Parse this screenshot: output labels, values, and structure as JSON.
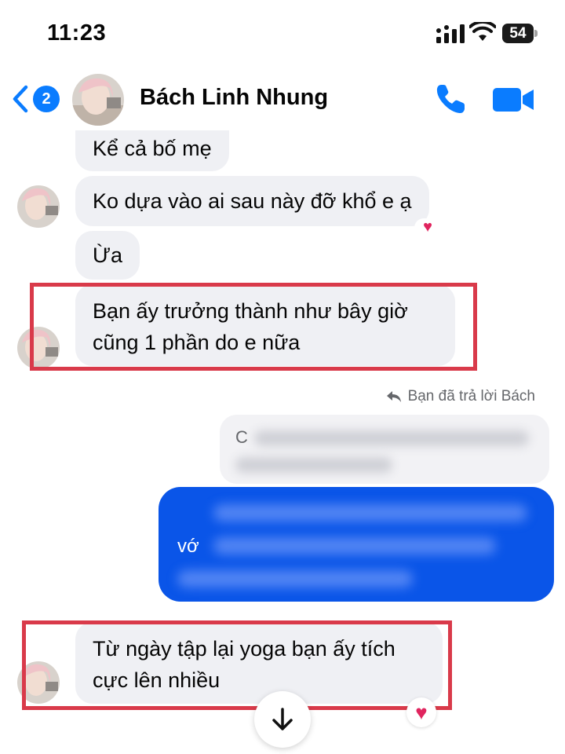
{
  "status_bar": {
    "time": "11:23",
    "battery": "54"
  },
  "header": {
    "back_badge_count": "2",
    "contact_name": "Bách Linh Nhung",
    "call_icon": "phone-icon",
    "video_icon": "video-camera-icon",
    "accent_color": "#0a7cff"
  },
  "messages": [
    {
      "text": "Kể cả bố mẹ"
    },
    {
      "text": "Ko dựa vào ai sau này đỡ khổ e ạ",
      "reaction": "heart"
    },
    {
      "text": "Ừa"
    },
    {
      "text_line1": "Bạn ấy trưởng thành như bây giờ",
      "text_line2": "cũng 1 phần do e nữa",
      "highlighted": true
    },
    {
      "text_line1": "Từ ngày tập lại yoga bạn ấy tích",
      "text_line2": "cực lên nhiều",
      "highlighted": true,
      "reaction": "heart"
    }
  ],
  "reply_note": "Bạn đã trả lời Bách",
  "quoted_fragment": "C",
  "outgoing_fragment": "vớ",
  "colors": {
    "incoming_bubble": "#eff0f4",
    "outgoing_bubble": "#0a55e8",
    "highlight_border": "#d93a4a"
  }
}
